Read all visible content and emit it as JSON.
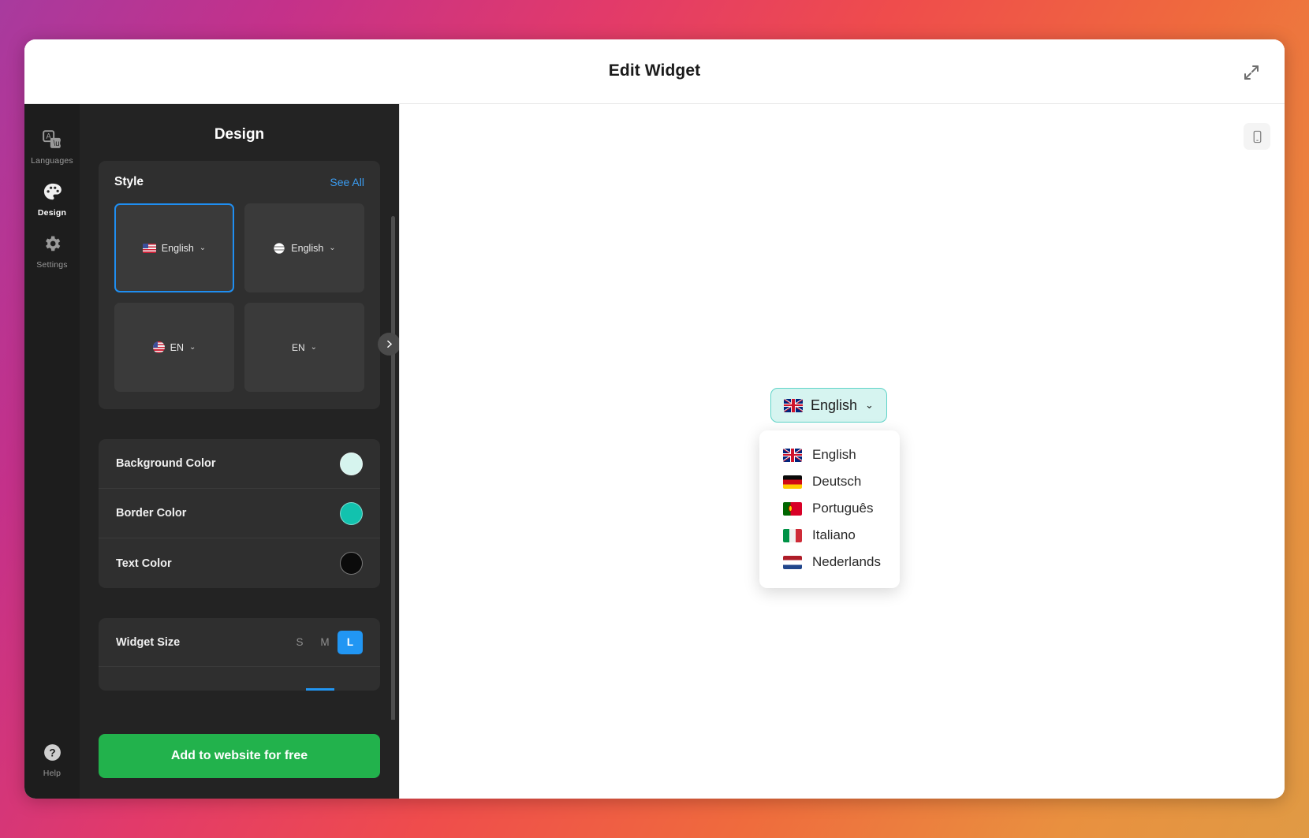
{
  "header": {
    "title": "Edit Widget",
    "expand_icon": "expand-arrows-icon"
  },
  "rail": {
    "items": [
      {
        "label": "Languages",
        "icon": "translate-icon",
        "active": false
      },
      {
        "label": "Design",
        "icon": "palette-icon",
        "active": true
      },
      {
        "label": "Settings",
        "icon": "gear-icon",
        "active": false
      }
    ],
    "help": {
      "label": "Help",
      "icon": "question-circle-icon"
    }
  },
  "design": {
    "title": "Design",
    "style": {
      "label": "Style",
      "see_all": "See All",
      "next_icon": "chevron-right-icon",
      "tiles": [
        {
          "icon": "us-flag-icon",
          "label": "English",
          "chevron": "⌄",
          "selected": true,
          "size": "normal"
        },
        {
          "icon": "globe-icon",
          "label": "English",
          "chevron": "⌄",
          "selected": false,
          "size": "normal"
        },
        {
          "icon": "us-flag-circle-icon",
          "label": "EN",
          "chevron": "⌄",
          "selected": false,
          "size": "normal"
        },
        {
          "icon": "none",
          "label": "EN",
          "chevron": "⌄",
          "selected": false,
          "size": "small"
        }
      ]
    },
    "colors": [
      {
        "label": "Background Color",
        "value": "#d6f4ee"
      },
      {
        "label": "Border Color",
        "value": "#12c2ae"
      },
      {
        "label": "Text Color",
        "value": "#0b0b0b"
      }
    ],
    "widget_size": {
      "label": "Widget Size",
      "options": [
        "S",
        "M",
        "L"
      ],
      "selected": "L"
    },
    "cta": "Add to website for free"
  },
  "preview": {
    "device_toggle_icon": "mobile-phone-icon",
    "widget": {
      "selected": {
        "flag": "uk-flag-icon",
        "label": "English",
        "chevron": "⌄"
      },
      "dropdown": [
        {
          "flag": "uk-flag-icon",
          "label": "English"
        },
        {
          "flag": "germany-flag-icon",
          "label": "Deutsch"
        },
        {
          "flag": "portugal-flag-icon",
          "label": "Português"
        },
        {
          "flag": "italy-flag-icon",
          "label": "Italiano"
        },
        {
          "flag": "netherlands-flag-icon",
          "label": "Nederlands"
        }
      ]
    }
  },
  "theme": {
    "accent_blue": "#2196f3",
    "link_blue": "#3b9cf0",
    "cta_green": "#22b24c",
    "panel_bg": "#232323",
    "rail_bg": "#1d1d1d"
  }
}
